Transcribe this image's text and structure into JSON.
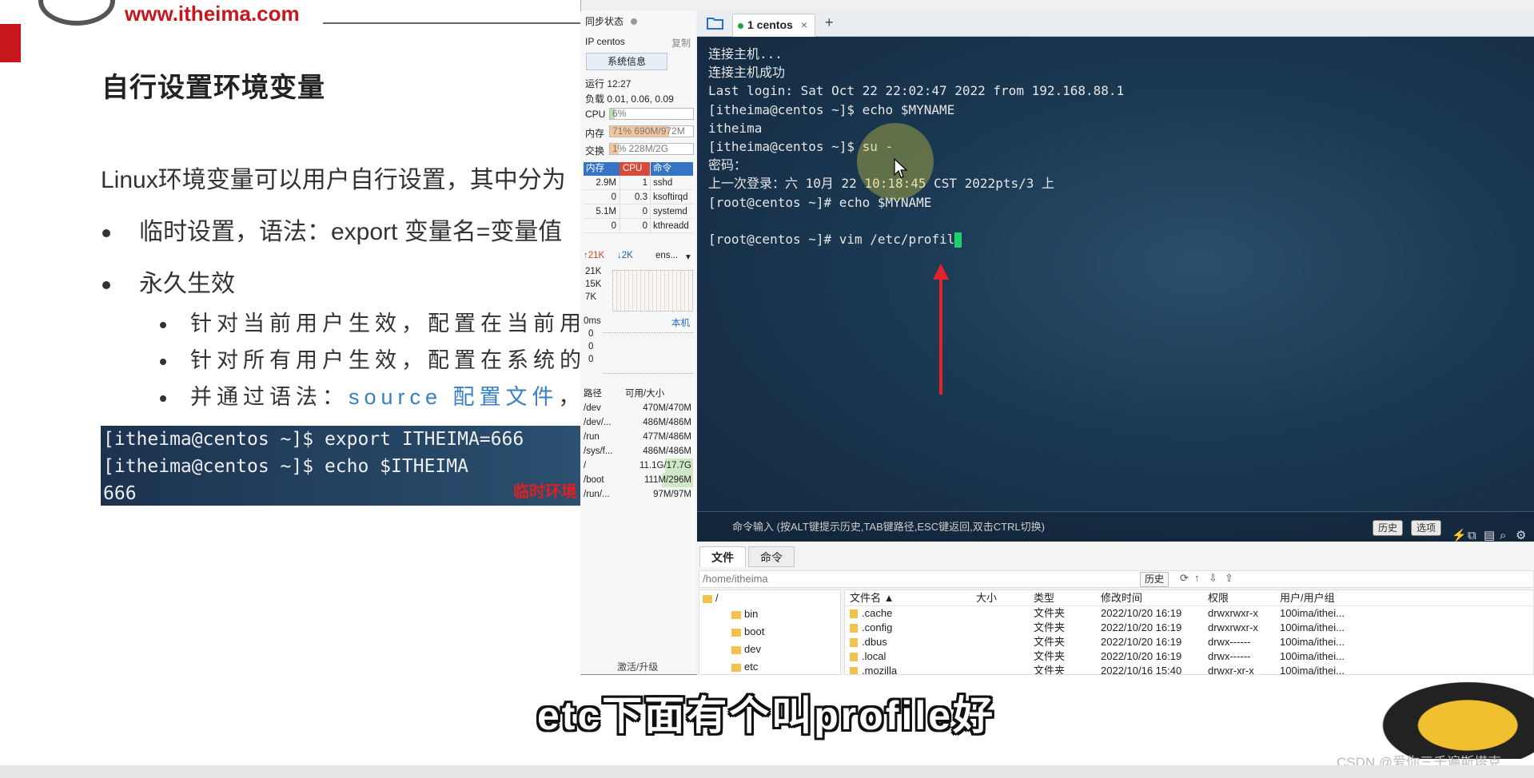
{
  "slide": {
    "site": "www.itheima.com",
    "title": "自行设置环境变量",
    "intro": "Linux环境变量可以用户自行设置，其中分为",
    "bullet1": "临时设置，语法：export 变量名=变量值",
    "bullet2": "永久生效",
    "sub1": "针对当前用户生效，配置在当前用户",
    "sub2": "针对所有用户生效，配置在系统的",
    "sub3_pre": "并通过语法：",
    "sub3_code": "source 配置文件",
    "sub3_post": "，进行",
    "code_lines": [
      "[itheima@centos ~]$ export ITHEIMA=666",
      "[itheima@centos ~]$ echo $ITHEIMA",
      "666"
    ],
    "code_label": "临时环境"
  },
  "left_panel": {
    "sync_label": "同步状态",
    "ip_label": "IP centos",
    "copy_label": "复制",
    "sysinfo_button": "系统信息",
    "uptime": "运行 12:27",
    "load": "负载 0.01, 0.06, 0.09",
    "cpu_label": "CPU",
    "cpu_value": "6%",
    "cpu_fraction": 0.06,
    "mem_label": "内存",
    "mem_value": "71% 690M/972M",
    "mem_fraction": 0.71,
    "swap_label": "交换",
    "swap_value": "1%     228M/2G",
    "swap_fraction": 0.11,
    "proc_headers": [
      "内存",
      "CPU",
      "命令"
    ],
    "processes": [
      {
        "mem": "2.9M",
        "cpu": "1",
        "cmd": "sshd"
      },
      {
        "mem": "0",
        "cpu": "0.3",
        "cmd": "ksoftirqd"
      },
      {
        "mem": "5.1M",
        "cpu": "0",
        "cmd": "systemd"
      },
      {
        "mem": "0",
        "cpu": "0",
        "cmd": "kthreadd"
      }
    ],
    "net_up": "↑21K",
    "net_down": "↓2K",
    "net_iface": "ens...",
    "net_ticks": [
      "21K",
      "15K",
      "7K"
    ],
    "latency_label": "0ms",
    "latency_host": "本机",
    "latency_ticks": [
      "0",
      "0",
      "0"
    ],
    "disk_headers": [
      "路径",
      "可用/大小"
    ],
    "disks": [
      {
        "path": "/dev",
        "size": "470M/470M"
      },
      {
        "path": "/dev/...",
        "size": "486M/486M"
      },
      {
        "path": "/run",
        "size": "477M/486M"
      },
      {
        "path": "/sys/f...",
        "size": "486M/486M"
      },
      {
        "path": "/",
        "size": "11.1G/17.7G"
      },
      {
        "path": "/boot",
        "size": "111M/296M"
      },
      {
        "path": "/run/...",
        "size": "97M/97M"
      }
    ],
    "activate": "激活/升级"
  },
  "terminal": {
    "tab_label": "1 centos",
    "tab_close": "×",
    "new_tab": "+",
    "lines": [
      "连接主机...",
      "连接主机成功",
      "Last login: Sat Oct 22 22:02:47 2022 from 192.168.88.1",
      "[itheima@centos ~]$ echo $MYNAME",
      "itheima",
      "[itheima@centos ~]$ su -",
      "密码：",
      "上一次登录：六 10月 22 10:18:45 CST 2022pts/3 上",
      "[root@centos ~]# echo $MYNAME",
      "",
      "[root@centos ~]# vim /etc/profil"
    ],
    "cmd_hint": "命令输入 (按ALT键提示历史,TAB键路径,ESC键返回,双击CTRL切换)",
    "history_button": "历史",
    "options_button": "选项"
  },
  "files": {
    "tab_files": "文件",
    "tab_commands": "命令",
    "path": "/home/itheima",
    "history_button": "历史",
    "tree": [
      "/",
      "bin",
      "boot",
      "dev",
      "etc"
    ],
    "headers": [
      "文件名 ▲",
      "大小",
      "类型",
      "修改时间",
      "权限",
      "用户/用户组"
    ],
    "rows": [
      {
        "name": ".cache",
        "size": "",
        "type": "文件夹",
        "mtime": "2022/10/20 16:19",
        "perm": "drwxrwxr-x",
        "owner": "100ima/ithei..."
      },
      {
        "name": ".config",
        "size": "",
        "type": "文件夹",
        "mtime": "2022/10/20 16:19",
        "perm": "drwxrwxr-x",
        "owner": "100ima/ithei..."
      },
      {
        "name": ".dbus",
        "size": "",
        "type": "文件夹",
        "mtime": "2022/10/20 16:19",
        "perm": "drwx------",
        "owner": "100ima/ithei..."
      },
      {
        "name": ".local",
        "size": "",
        "type": "文件夹",
        "mtime": "2022/10/20 16:19",
        "perm": "drwx------",
        "owner": "100ima/ithei..."
      },
      {
        "name": ".mozilla",
        "size": "",
        "type": "文件夹",
        "mtime": "2022/10/16 15:40",
        "perm": "drwxr-xr-x",
        "owner": "100ima/ithei..."
      }
    ]
  },
  "overlay": {
    "subtitle": "etc下面有个叫profile好",
    "watermark": "CSDN @爱你三千遍斯塔克"
  }
}
